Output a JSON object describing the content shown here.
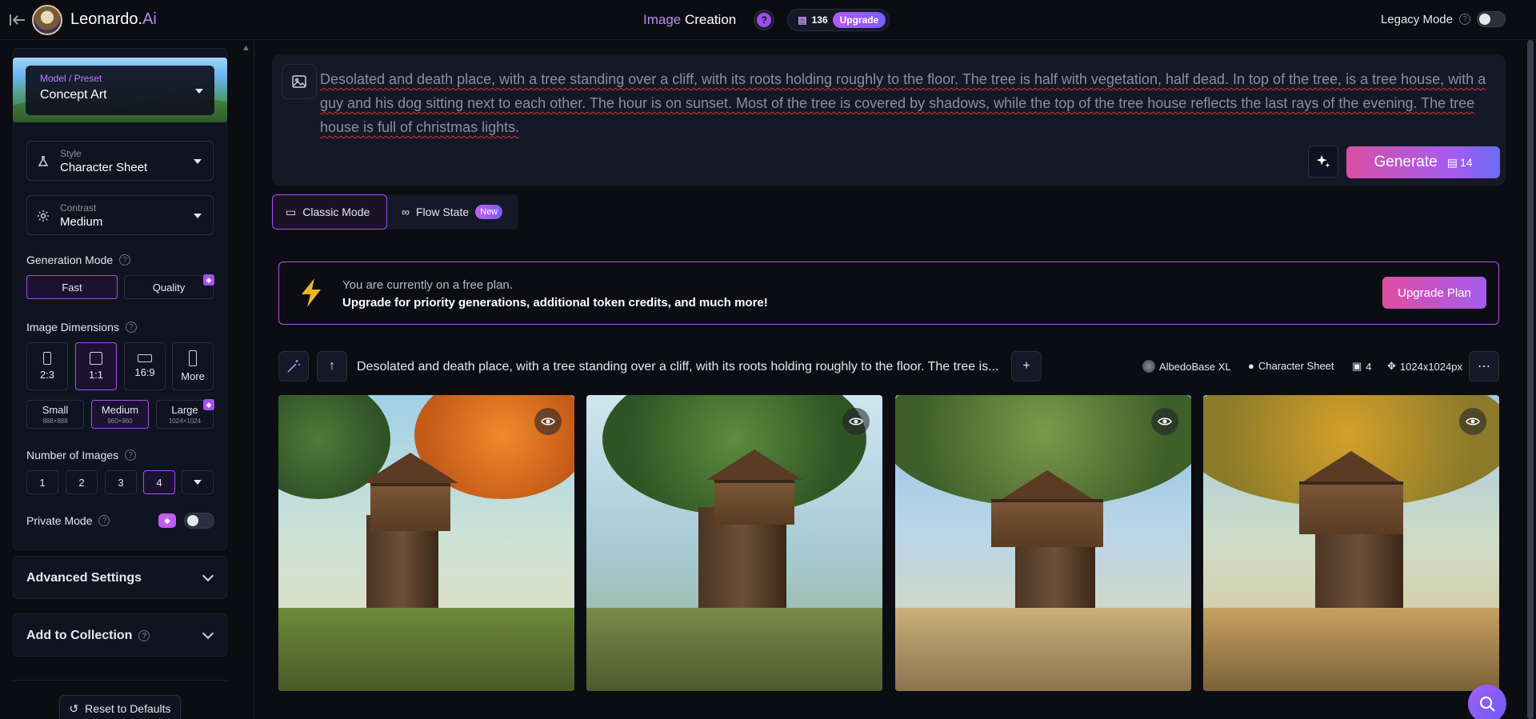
{
  "app": {
    "brand_name": "Leonardo.",
    "brand_suffix": "Ai",
    "nav_title_accent": "Image",
    "nav_title_rest": "Creation",
    "help_glyph": "?",
    "tokens": "136",
    "upgrade_label": "Upgrade",
    "legacy_mode_label": "Legacy Mode",
    "legacy_mode_enabled": false
  },
  "sidebar": {
    "model": {
      "label": "Model / Preset",
      "value": "Concept Art"
    },
    "style": {
      "label": "Style",
      "value": "Character Sheet"
    },
    "contrast": {
      "label": "Contrast",
      "value": "Medium"
    },
    "generation_mode": {
      "title": "Generation Mode",
      "options": [
        "Fast",
        "Quality"
      ],
      "selected": "Fast"
    },
    "image_dimensions": {
      "title": "Image Dimensions",
      "ratios": [
        "2:3",
        "1:1",
        "16:9",
        "More"
      ],
      "selected_ratio": "1:1",
      "sizes": [
        {
          "label": "Small",
          "sub": "888×888"
        },
        {
          "label": "Medium",
          "sub": "960×960"
        },
        {
          "label": "Large",
          "sub": "1024×1024"
        }
      ],
      "selected_size": "Medium"
    },
    "number_of_images": {
      "title": "Number of Images",
      "options": [
        "1",
        "2",
        "3",
        "4"
      ],
      "selected": "4"
    },
    "private_mode": {
      "label": "Private Mode",
      "enabled": false
    },
    "advanced_settings_label": "Advanced Settings",
    "add_to_collection_label": "Add to Collection",
    "reset_label": "Reset to Defaults"
  },
  "prompt": {
    "text": "Desolated and death place, with a tree standing over a cliff, with its roots holding roughly to the floor. The tree is half with vegetation, half dead. In top of the tree, is a tree house, with a guy and his dog sitting next to each other. The hour is on sunset. Most of the tree is covered by shadows, while the top of the tree house reflects the last rays of the evening. The tree house is full of christmas lights.",
    "generate_label": "Generate",
    "generate_cost": "14"
  },
  "mode_tabs": {
    "classic": "Classic Mode",
    "flow": "Flow State",
    "flow_badge": "New"
  },
  "banner": {
    "line1": "You are currently on a free plan.",
    "line2": "Upgrade for priority generations, additional token credits, and much more!",
    "button": "Upgrade Plan"
  },
  "generation": {
    "prompt_preview": "Desolated and death place, with a tree standing over a cliff, with its roots holding roughly to the floor. The tree is...",
    "model": "AlbedoBase XL",
    "style": "Character Sheet",
    "count": "4",
    "dimensions": "1024x1024px",
    "images": [
      {
        "name": "treehouse-autumn"
      },
      {
        "name": "treehouse-waterfall"
      },
      {
        "name": "treehouse-sunlit"
      },
      {
        "name": "treehouse-golden"
      }
    ]
  },
  "colors": {
    "accent": "#a74ff0",
    "brand_purple": "#b48cf0",
    "generate_gradient_start": "#d94fa5",
    "generate_gradient_end": "#6a6cf5",
    "background": "#0b0d13",
    "panel": "#151826"
  },
  "icons": {
    "back": "arrow-left-to-line-icon",
    "prompt": "image-icon",
    "enhance": "sparkles-icon",
    "token": "coins-icon",
    "bolt": "lightning-bolt-icon",
    "search": "search-icon"
  }
}
